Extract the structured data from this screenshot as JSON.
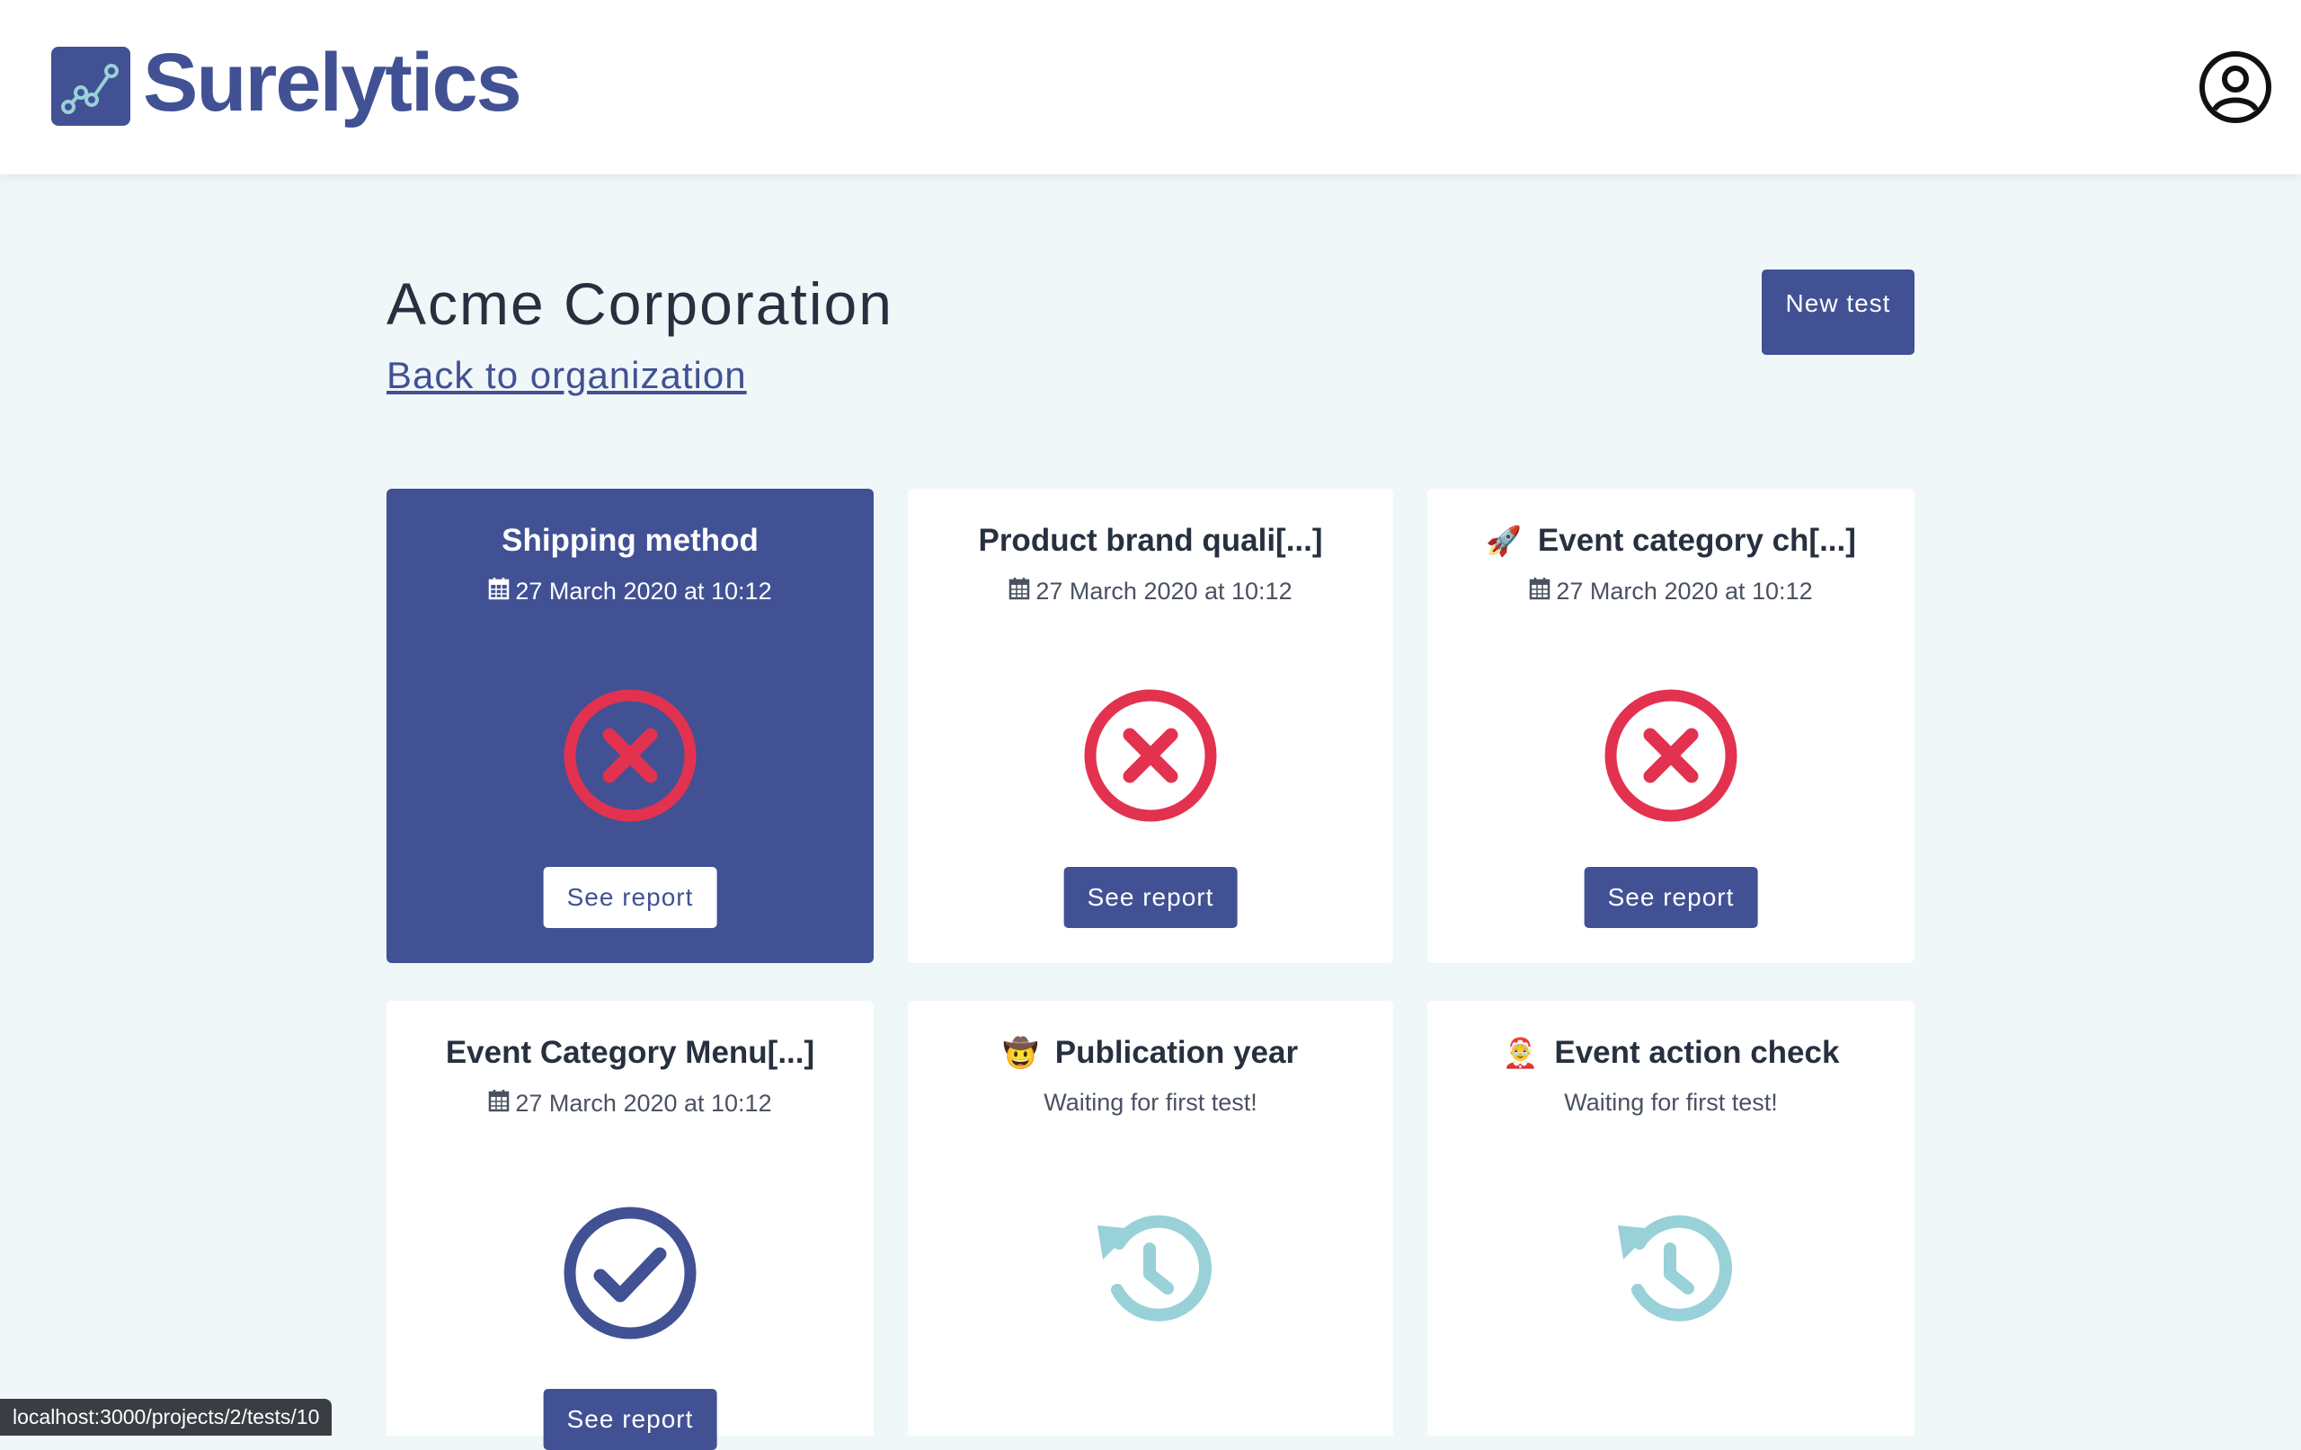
{
  "header": {
    "brand_name": "Surelytics",
    "logo_icon": "line-chart-icon",
    "account_icon": "user-circle-icon"
  },
  "page": {
    "title": "Acme Corporation",
    "back_link": "Back to organization",
    "new_test_label": "New test"
  },
  "colors": {
    "brand": "#415194",
    "fail": "#e2324f",
    "pending": "#98d1d8",
    "background": "#f0f7f8"
  },
  "tests": [
    {
      "title": "Shipping method",
      "emoji": "",
      "date": "27 March 2020 at 10:12",
      "status": "failed",
      "status_icon": "x-circle-icon",
      "button": "See report",
      "active": true
    },
    {
      "title": "Product brand quali[...]",
      "emoji": "",
      "date": "27 March 2020 at 10:12",
      "status": "failed",
      "status_icon": "x-circle-icon",
      "button": "See report"
    },
    {
      "title": "Event category ch[...]",
      "emoji": "🚀",
      "date": "27 March 2020 at 10:12",
      "status": "failed",
      "status_icon": "x-circle-icon",
      "button": "See report"
    },
    {
      "title": "Event Category Menu[...]",
      "emoji": "",
      "date": "27 March 2020 at 10:12",
      "status": "passed",
      "status_icon": "check-circle-icon",
      "button": "See report"
    },
    {
      "title": "Publication year",
      "emoji": "🤠",
      "waiting": "Waiting for first test!",
      "status": "pending",
      "status_icon": "history-icon"
    },
    {
      "title": "Event action check",
      "emoji": "🤶",
      "waiting": "Waiting for first test!",
      "status": "pending",
      "status_icon": "history-icon"
    }
  ],
  "statusbar": {
    "url": "localhost:3000/projects/2/tests/10"
  }
}
